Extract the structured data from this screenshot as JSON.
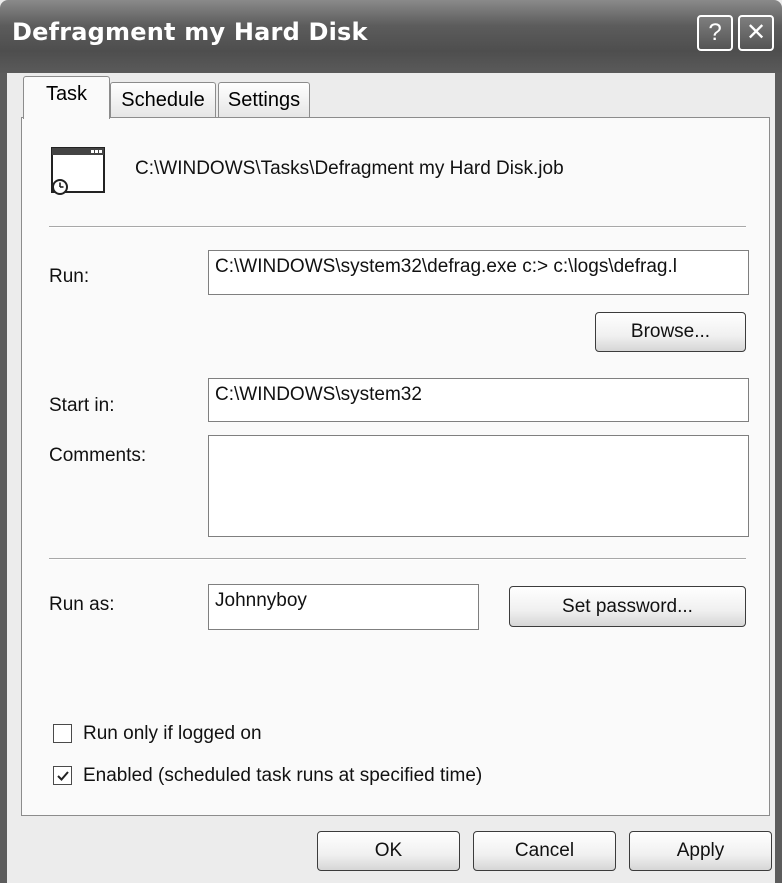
{
  "window": {
    "title": "Defragment my Hard Disk",
    "help_glyph": "?",
    "close_glyph": "✕"
  },
  "tabs": [
    {
      "label": "Task",
      "active": true
    },
    {
      "label": "Schedule",
      "active": false
    },
    {
      "label": "Settings",
      "active": false
    }
  ],
  "task": {
    "job_icon": "scheduled-task-icon",
    "job_path": "C:\\WINDOWS\\Tasks\\Defragment my Hard Disk.job",
    "run_label": "Run:",
    "run_value": "C:\\WINDOWS\\system32\\defrag.exe c:> c:\\logs\\defrag.l",
    "browse_label": "Browse...",
    "start_in_label": "Start in:",
    "start_in_value": "C:\\WINDOWS\\system32",
    "comments_label": "Comments:",
    "comments_value": "",
    "run_as_label": "Run as:",
    "run_as_value": "Johnnyboy",
    "set_password_label": "Set password...",
    "run_only_logged_on_label": "Run only if logged on",
    "run_only_logged_on_checked": false,
    "enabled_label": "Enabled (scheduled task runs at specified time)",
    "enabled_checked": true
  },
  "footer": {
    "ok_label": "OK",
    "cancel_label": "Cancel",
    "apply_label": "Apply"
  }
}
